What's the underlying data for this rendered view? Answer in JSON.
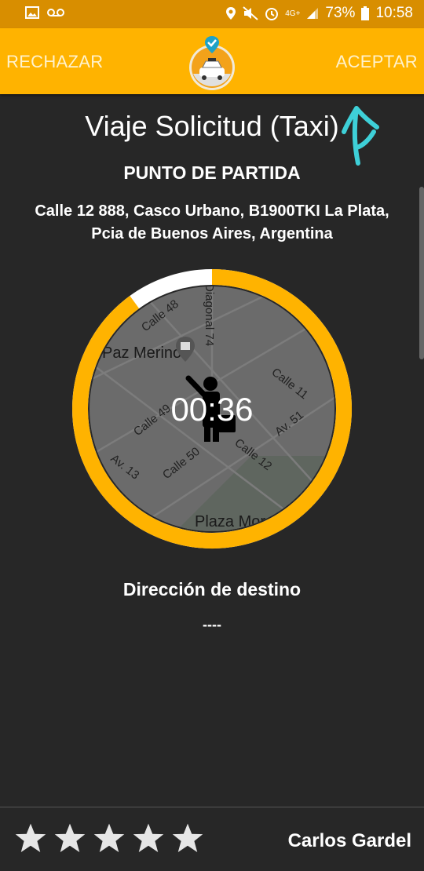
{
  "status_bar": {
    "battery": "73%",
    "time": "10:58",
    "network": "4G+",
    "left_icons": [
      "image-icon",
      "voicemail-icon"
    ],
    "right_icons": [
      "location-icon",
      "mute-icon",
      "alarm-icon",
      "network-icon",
      "signal-icon",
      "battery-icon"
    ]
  },
  "topbar": {
    "reject_label": "RECHAZAR",
    "accept_label": "ACEPTAR",
    "logo_icon": "taxi-app-logo-icon",
    "color": "#FFB300"
  },
  "content": {
    "title": "Viaje Solicitud (Taxi)",
    "pickup_label": "PUNTO DE PARTIDA",
    "pickup_address_line1": "Calle 12 888, Casco Urbano, B1900TKI La Plata,",
    "pickup_address_line2": "Pcia de Buenos Aires, Argentina",
    "destination_label": "Dirección de destino",
    "destination_value": "----"
  },
  "timer": {
    "countdown": "00:36",
    "remaining_fraction": 0.9,
    "ring_color": "#FFB300"
  },
  "map": {
    "streets": [
      "Calle 48",
      "Diagonal 74",
      "Calle 11",
      "Av. 51",
      "Calle 49",
      "Calle 50",
      "Calle 12",
      "Av. 13"
    ],
    "places": [
      "Paz Merino",
      "Plaza Moreno"
    ]
  },
  "footer": {
    "rating_stars": 5,
    "driver_name": "Carlos Gardel"
  }
}
